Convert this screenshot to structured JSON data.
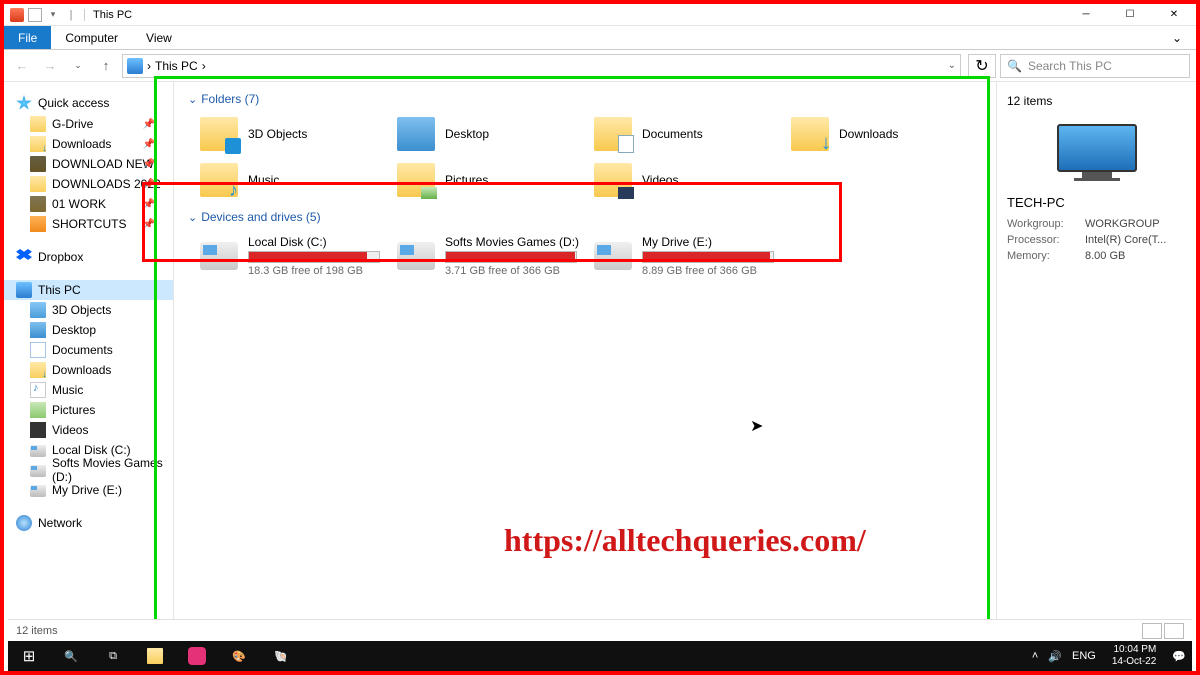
{
  "window": {
    "title": "This PC"
  },
  "ribbon": {
    "file": "File",
    "computer": "Computer",
    "view": "View"
  },
  "address": {
    "crumb": "This PC",
    "sep": "›",
    "search_placeholder": "Search This PC"
  },
  "sidebar": {
    "quick": {
      "label": "Quick access",
      "items": [
        {
          "label": "G-Drive",
          "icon": "folder",
          "pin": true
        },
        {
          "label": "Downloads",
          "icon": "dl",
          "pin": true
        },
        {
          "label": "DOWNLOAD NEW",
          "icon": "folder",
          "pin": true
        },
        {
          "label": "DOWNLOADS 2022",
          "icon": "folder",
          "pin": true
        },
        {
          "label": "01 WORK",
          "icon": "folder",
          "pin": true
        },
        {
          "label": "SHORTCUTS",
          "icon": "shortcut",
          "pin": true
        }
      ]
    },
    "dropbox": {
      "label": "Dropbox"
    },
    "thispc": {
      "label": "This PC",
      "items": [
        {
          "label": "3D Objects",
          "icon": "folder blue-badge"
        },
        {
          "label": "Desktop",
          "icon": "desk"
        },
        {
          "label": "Documents",
          "icon": "doc"
        },
        {
          "label": "Downloads",
          "icon": "dl"
        },
        {
          "label": "Music",
          "icon": "music"
        },
        {
          "label": "Pictures",
          "icon": "pic"
        },
        {
          "label": "Videos",
          "icon": "vid"
        },
        {
          "label": "Local Disk (C:)",
          "icon": "disk"
        },
        {
          "label": "Softs Movies Games (D:)",
          "icon": "disk"
        },
        {
          "label": "My Drive (E:)",
          "icon": "disk"
        }
      ]
    },
    "network": {
      "label": "Network"
    }
  },
  "main": {
    "folders_head": "Folders (7)",
    "folders": [
      {
        "label": "3D Objects"
      },
      {
        "label": "Desktop"
      },
      {
        "label": "Documents"
      },
      {
        "label": "Downloads"
      },
      {
        "label": "Music"
      },
      {
        "label": "Pictures"
      },
      {
        "label": "Videos"
      }
    ],
    "drives_head": "Devices and drives (5)",
    "drives": [
      {
        "label": "Local Disk (C:)",
        "free": "18.3 GB free of 198 GB",
        "fill": 91
      },
      {
        "label": "Softs Movies Games (D:)",
        "free": "3.71 GB free of 366 GB",
        "fill": 99
      },
      {
        "label": "My Drive (E:)",
        "free": "8.89 GB free of 366 GB",
        "fill": 98
      }
    ]
  },
  "details": {
    "count": "12 items",
    "name": "TECH-PC",
    "rows": [
      {
        "k": "Workgroup:",
        "v": "WORKGROUP"
      },
      {
        "k": "Processor:",
        "v": "Intel(R) Core(T..."
      },
      {
        "k": "Memory:",
        "v": "8.00 GB"
      }
    ]
  },
  "status": {
    "text": "12 items"
  },
  "taskbar": {
    "lang": "ENG",
    "time": "10:04 PM",
    "date": "14-Oct-22"
  },
  "watermark": "https://alltechqueries.com/"
}
